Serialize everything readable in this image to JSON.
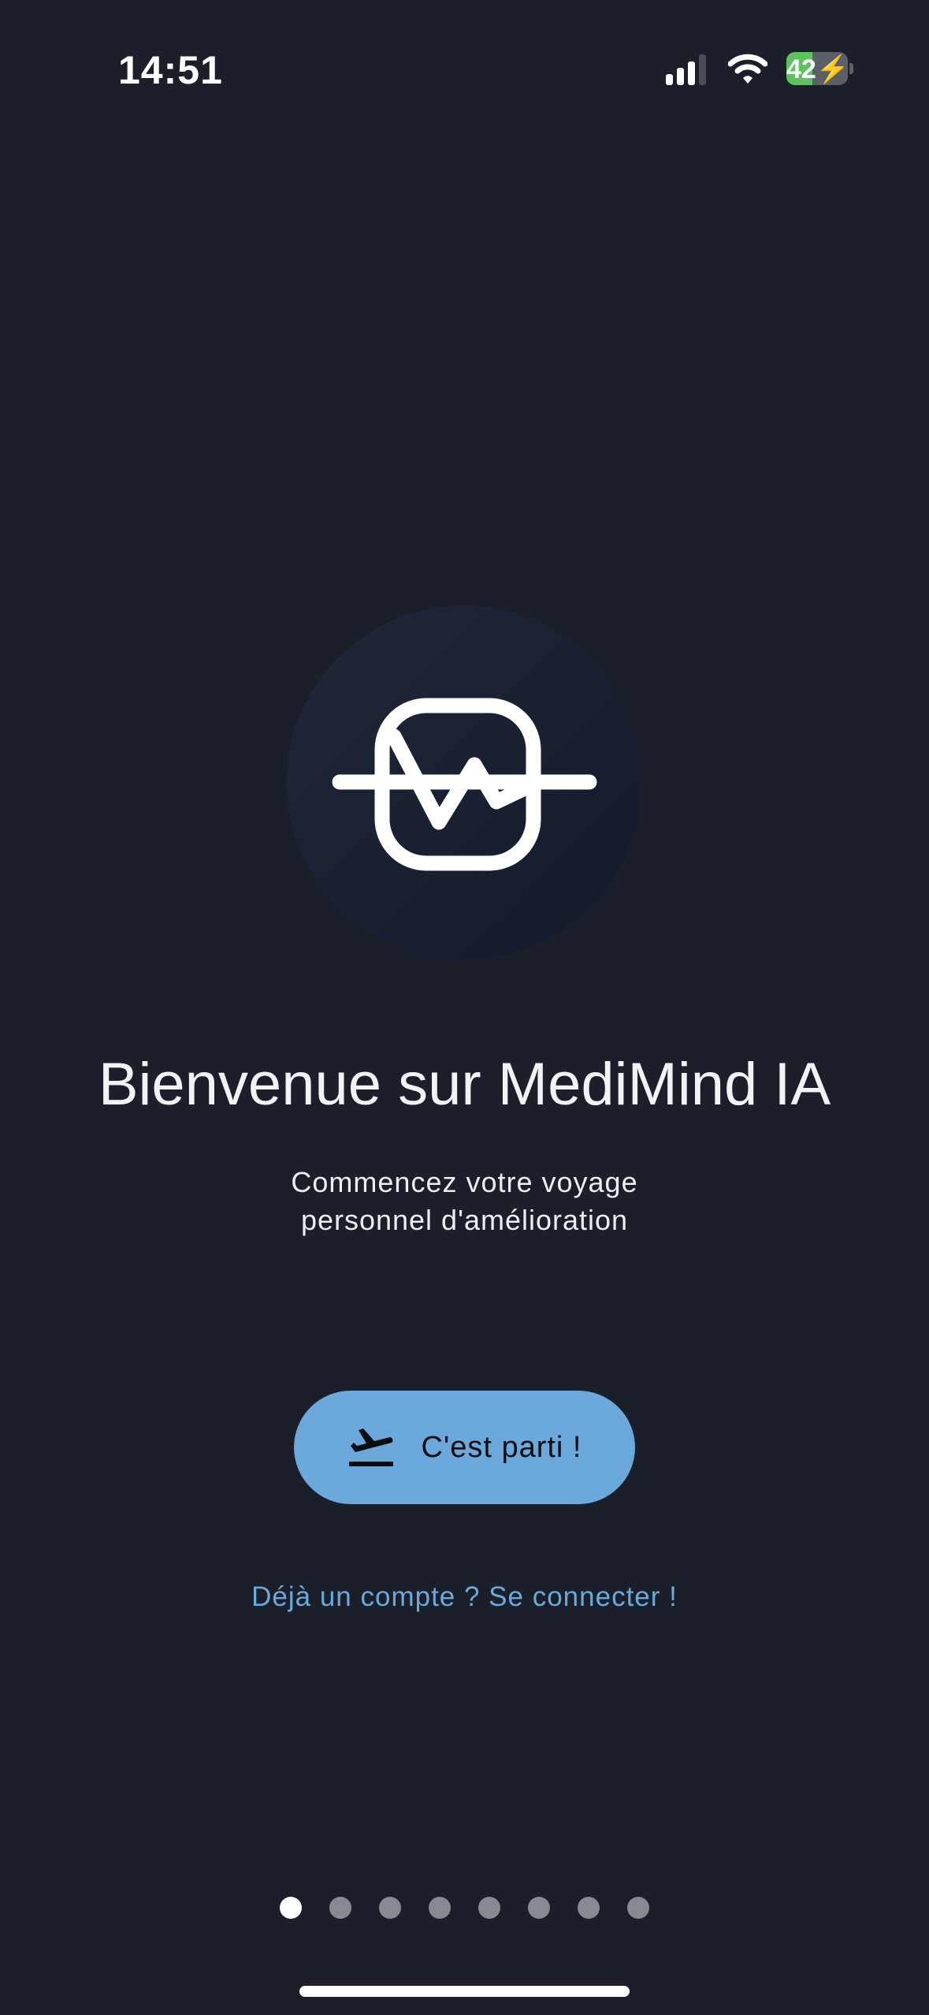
{
  "status_bar": {
    "time": "14:51",
    "battery": "42",
    "battery_level_percent": 42,
    "signal_bars": 3,
    "icons": [
      "signal-icon",
      "wifi-icon",
      "battery-charging-icon"
    ]
  },
  "welcome": {
    "title": "Bienvenue sur MediMind IA",
    "subtitle_line1": "Commencez votre voyage",
    "subtitle_line2": "personnel d'amélioration",
    "logo_icon": "heartbeat-square-icon"
  },
  "actions": {
    "start_label": "C'est parti !",
    "start_icon": "airplane-takeoff-icon",
    "login_link": "Déjà un compte ? Se connecter !"
  },
  "pagination": {
    "total": 8,
    "active_index": 0
  },
  "colors": {
    "background": "#1a1f29",
    "accent": "#6ba9dc",
    "battery": "#5dc25f"
  }
}
